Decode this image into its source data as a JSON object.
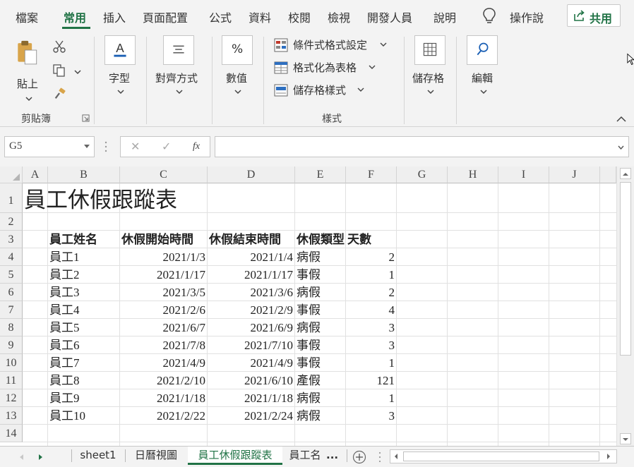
{
  "menu": {
    "tabs": [
      "檔案",
      "常用",
      "插入",
      "頁面配置",
      "公式",
      "資料",
      "校閱",
      "檢視",
      "開發人員",
      "說明"
    ],
    "active_index": 1,
    "tell_me": "操作說",
    "share_label": "共用"
  },
  "ribbon": {
    "paste_label": "貼上",
    "clipboard_label": "剪貼簿",
    "font_label": "字型",
    "alignment_label": "對齊方式",
    "number_label": "數值",
    "number_icon": "%",
    "conditional_format_label": "條件式格式設定",
    "format_as_table_label": "格式化為表格",
    "cell_styles_label": "儲存格樣式",
    "styles_group_label": "樣式",
    "cells_label": "儲存格",
    "editing_label": "編輯"
  },
  "formula_bar": {
    "name_box": "G5",
    "cancel_symbol": "✕",
    "enter_symbol": "✓",
    "fx_symbol": "fx",
    "formula": ""
  },
  "grid": {
    "columns": [
      "A",
      "B",
      "C",
      "D",
      "E",
      "F",
      "G",
      "H",
      "I",
      "J"
    ],
    "rows": [
      "1",
      "2",
      "3",
      "4",
      "5",
      "6",
      "7",
      "8",
      "9",
      "10",
      "11",
      "12",
      "13",
      "14"
    ],
    "title": "員工休假跟蹤表",
    "headers": [
      "員工姓名",
      "休假開始時間",
      "休假結束時間",
      "休假類型",
      "天數"
    ],
    "records": [
      [
        "員工1",
        "2021/1/3",
        "2021/1/4",
        "病假",
        "2"
      ],
      [
        "員工2",
        "2021/1/17",
        "2021/1/17",
        "事假",
        "1"
      ],
      [
        "員工3",
        "2021/3/5",
        "2021/3/6",
        "病假",
        "2"
      ],
      [
        "員工4",
        "2021/2/6",
        "2021/2/9",
        "事假",
        "4"
      ],
      [
        "員工5",
        "2021/6/7",
        "2021/6/9",
        "病假",
        "3"
      ],
      [
        "員工6",
        "2021/7/8",
        "2021/7/10",
        "事假",
        "3"
      ],
      [
        "員工7",
        "2021/4/9",
        "2021/4/9",
        "事假",
        "1"
      ],
      [
        "員工8",
        "2021/2/10",
        "2021/6/10",
        "產假",
        "121"
      ],
      [
        "員工9",
        "2021/1/18",
        "2021/1/18",
        "病假",
        "1"
      ],
      [
        "員工10",
        "2021/2/22",
        "2021/2/24",
        "病假",
        "3"
      ]
    ]
  },
  "sheets": {
    "tabs": [
      "sheet1",
      "日曆視圖",
      "員工休假跟蹤表",
      "員工名"
    ],
    "active_index": 2,
    "overflow": "..."
  },
  "colors": {
    "accent": "#217346"
  }
}
